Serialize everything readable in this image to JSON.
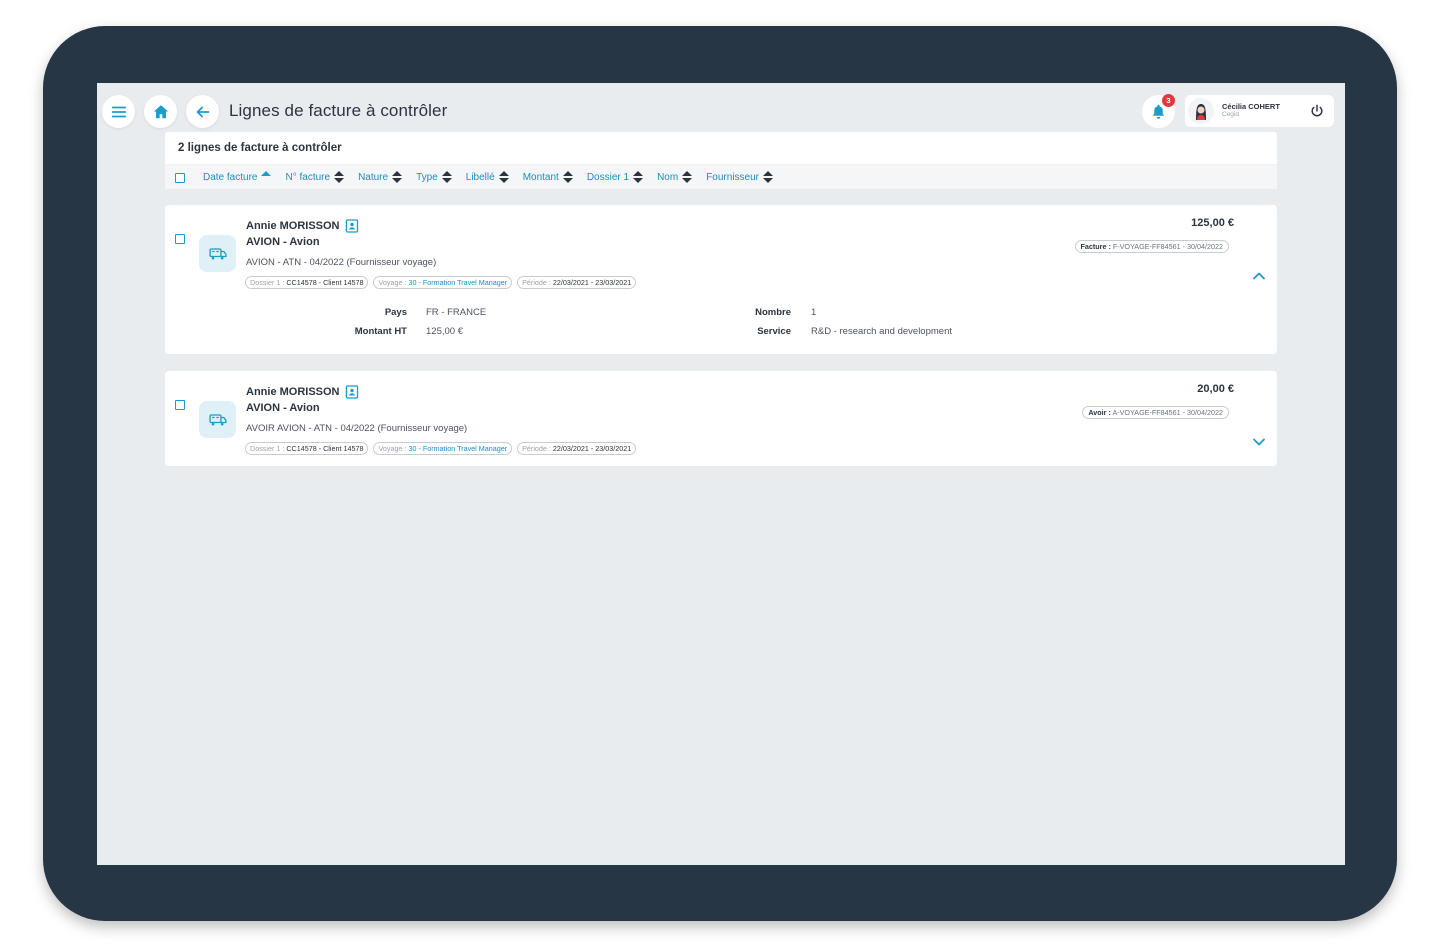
{
  "header": {
    "title": "Lignes de facture à contrôler",
    "notifications_count": "3",
    "user_name": "Cécilia COHERT",
    "user_company": "Cegid"
  },
  "list": {
    "count_label": "2 lignes de facture à contrôler",
    "sort_columns": [
      {
        "label": "Date facture",
        "active": true
      },
      {
        "label": "N° facture"
      },
      {
        "label": "Nature"
      },
      {
        "label": "Type"
      },
      {
        "label": "Libellé"
      },
      {
        "label": "Montant"
      },
      {
        "label": "Dossier 1"
      },
      {
        "label": "Nom"
      },
      {
        "label": "Fournisseur"
      }
    ]
  },
  "lines": [
    {
      "person": "Annie MORISSON",
      "title": "AVION - Avion",
      "description": "AVION - ATN - 04/2022 (Fournisseur voyage)",
      "tag_dossier_key": "Dossier 1 :",
      "tag_dossier_val": "CC14578 - Client 14578",
      "tag_voyage_key": "Voyage :",
      "tag_voyage_val": "30 - Formation Travel Manager",
      "tag_periode_key": "Période :",
      "tag_periode_val": "22/03/2021 - 23/03/2021",
      "amount": "125,00 €",
      "doc_key": "Facture :",
      "doc_val": "F-VOYAGE-FF84561 - 30/04/2022",
      "expanded": true,
      "details": {
        "pays_label": "Pays",
        "pays_value": "FR - FRANCE",
        "montant_label": "Montant HT",
        "montant_value": "125,00 €",
        "nombre_label": "Nombre",
        "nombre_value": "1",
        "service_label": "Service",
        "service_value": "R&D - research and development"
      }
    },
    {
      "person": "Annie MORISSON",
      "title": "AVION - Avion",
      "description": "AVOIR AVION - ATN - 04/2022 (Fournisseur voyage)",
      "tag_dossier_key": "Dossier 1 :",
      "tag_dossier_val": "CC14578 - Client 14578",
      "tag_voyage_key": "Voyage :",
      "tag_voyage_val": "30 - Formation Travel Manager",
      "tag_periode_key": "Période :",
      "tag_periode_val": "22/03/2021 - 23/03/2021",
      "amount": "20,00 €",
      "doc_key": "Avoir :",
      "doc_val": "A-VOYAGE-FF84561 - 30/04/2022",
      "expanded": false
    }
  ],
  "colors": {
    "accent": "#1b9cc9",
    "frame": "#263645",
    "screen_bg": "#e9ecef",
    "badge": "#e0393e"
  },
  "icons": [
    "menu-icon",
    "home-icon",
    "back-arrow-icon",
    "bell-icon",
    "avatar",
    "power-icon",
    "train-icon",
    "contact-card-icon",
    "chevron-up-icon",
    "chevron-down-icon"
  ]
}
